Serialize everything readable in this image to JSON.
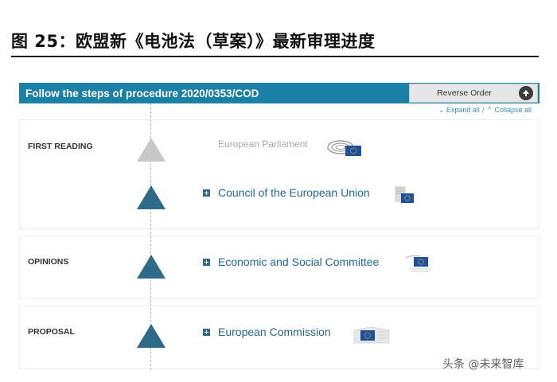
{
  "figure": {
    "title": "图 25：欧盟新《电池法（草案）》最新审理进度"
  },
  "procedure": {
    "header_title": "Follow the steps of procedure 2020/0353/COD",
    "reverse_label": "Reverse Order",
    "expand_all": "Expand all",
    "collapse_all": "Collapse all",
    "expand_sep": "/"
  },
  "stages": [
    {
      "label": "FIRST READING",
      "institutions": [
        {
          "name": "European Parliament",
          "status": "pending",
          "icon": "parliament-icon"
        },
        {
          "name": "Council of the European Union",
          "status": "active",
          "icon": "council-icon"
        }
      ]
    },
    {
      "label": "OPINIONS",
      "institutions": [
        {
          "name": "Economic and Social Committee",
          "status": "active",
          "icon": "committee-icon"
        }
      ]
    },
    {
      "label": "PROPOSAL",
      "institutions": [
        {
          "name": "European Commission",
          "status": "active",
          "icon": "commission-icon"
        }
      ]
    }
  ],
  "watermark": "头条 @未来智库",
  "colors": {
    "header": "#1a80a6",
    "active": "#2e6b8a",
    "pending": "#c7c7c7",
    "link": "#3a8dc2",
    "eu_blue": "#1f4fa0",
    "eu_star": "#f4d000"
  }
}
